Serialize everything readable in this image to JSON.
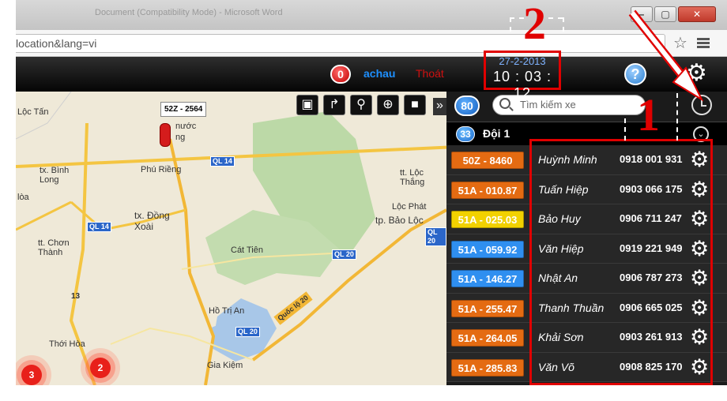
{
  "browser": {
    "title_fragment": "Document (Compatibility Mode) - Microsoft Word",
    "minimize": "–",
    "maximize": "▢",
    "close": "✕",
    "url": "location&lang=vi"
  },
  "header": {
    "notification_count": "0",
    "username": "achau",
    "logout": "Thoát",
    "date": "27-2-2013",
    "time": "10 : 03 : 12",
    "help": "?"
  },
  "map": {
    "selected_vehicle_label": "52Z - 2564",
    "tools": [
      "briefcase-icon",
      "share-icon",
      "zoom-icon",
      "locate-icon",
      "stop-icon"
    ],
    "collapse": "»",
    "places": [
      {
        "name": "Lộc Tấn"
      },
      {
        "name": "tx. Bình Long"
      },
      {
        "name": "Phú Riềng"
      },
      {
        "name": "tx. Đồng Xoài"
      },
      {
        "name": "tt. Chơn Thành"
      },
      {
        "name": "Cát Tiên"
      },
      {
        "name": "tt. Lộc Thắng"
      },
      {
        "name": "Lộc Phát"
      },
      {
        "name": "tp. Bảo Lộc"
      },
      {
        "name": "Hồ Trị An"
      },
      {
        "name": "Thới Hòa"
      },
      {
        "name": "Gia Kiệm"
      },
      {
        "name": "lòa"
      },
      {
        "name": "nước"
      },
      {
        "name": "ng"
      }
    ],
    "roads": [
      "QL 14",
      "QL 14",
      "QL 20",
      "QL 20",
      "QL 20",
      "Quốc lộ 20",
      "13"
    ],
    "clusters": [
      "3",
      "2"
    ]
  },
  "panel": {
    "vehicle_count": "80",
    "search_placeholder": "Tìm kiếm xe",
    "group": {
      "count": "33",
      "name": "Đội 1"
    },
    "vehicles": [
      {
        "plate": "50Z - 8460",
        "driver": "Huỳnh Minh",
        "phone": "0918 001 931",
        "color": "#e46b12"
      },
      {
        "plate": "51A - 010.87",
        "driver": "Tuấn Hiệp",
        "phone": "0903 066 175",
        "color": "#e46b12"
      },
      {
        "plate": "51A - 025.03",
        "driver": "Bảo Huy",
        "phone": "0906 711 247",
        "color": "#f2d100"
      },
      {
        "plate": "51A - 059.92",
        "driver": "Văn Hiệp",
        "phone": "0919 221 949",
        "color": "#2f8ff0"
      },
      {
        "plate": "51A - 146.27",
        "driver": "Nhật An",
        "phone": "0906 787 273",
        "color": "#2f8ff0"
      },
      {
        "plate": "51A - 255.47",
        "driver": "Thanh Thuần",
        "phone": "0906 665 025",
        "color": "#e46b12"
      },
      {
        "plate": "51A - 264.05",
        "driver": "Khải Sơn",
        "phone": "0903 261 913",
        "color": "#e46b12"
      },
      {
        "plate": "51A - 285.83",
        "driver": "Văn Võ",
        "phone": "0908 825 170",
        "color": "#e46b12"
      }
    ]
  },
  "annotations": {
    "label_1": "1",
    "label_2": "2"
  }
}
